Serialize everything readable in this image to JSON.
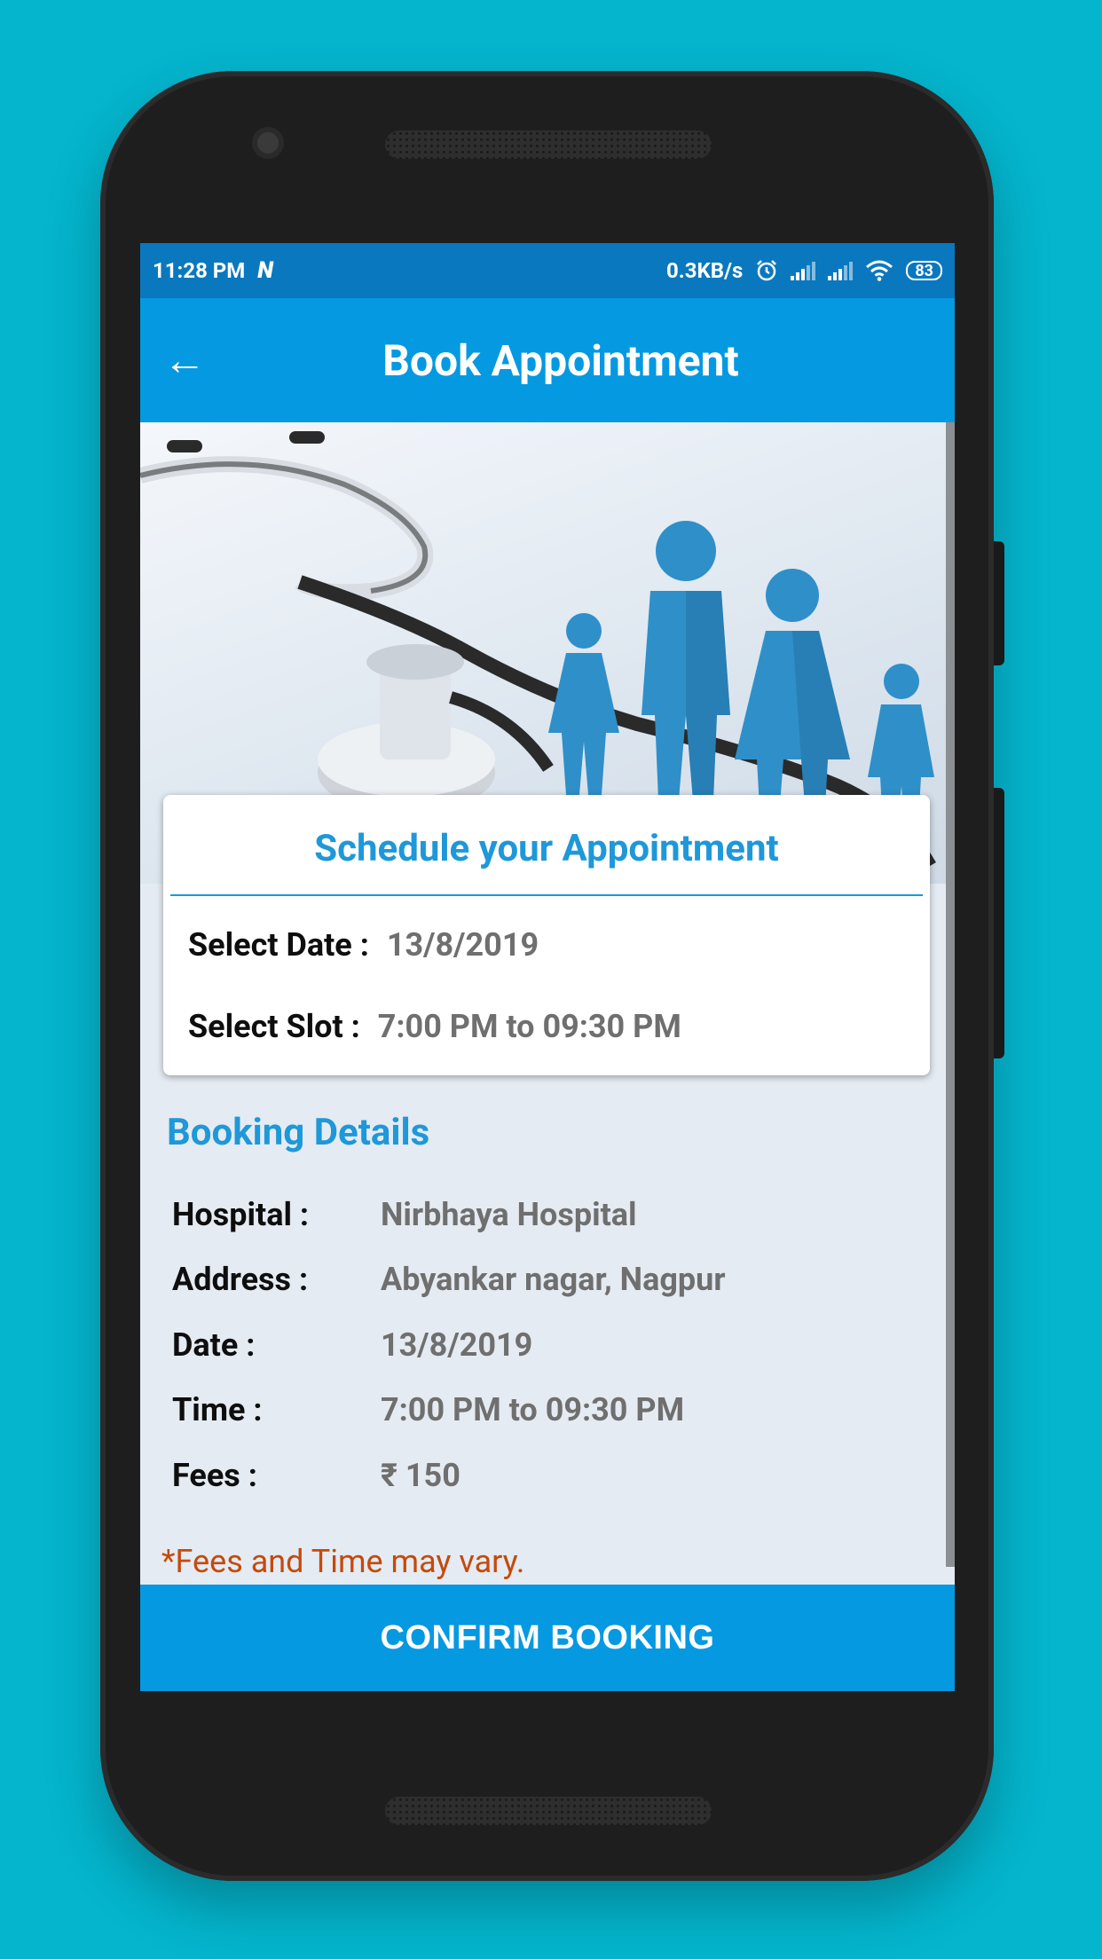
{
  "status_bar": {
    "time": "11:28 PM",
    "notification_icon": "N",
    "network_speed": "0.3KB/s",
    "battery": "83"
  },
  "app_bar": {
    "back_icon": "←",
    "title": "Book Appointment"
  },
  "schedule_card": {
    "title": "Schedule your Appointment",
    "date_label": "Select Date :",
    "date_value": "13/8/2019",
    "slot_label": "Select Slot :",
    "slot_value": "7:00 PM to 09:30 PM"
  },
  "booking_details": {
    "title": "Booking Details",
    "rows": [
      {
        "label": "Hospital :",
        "value": "Nirbhaya Hospital"
      },
      {
        "label": "Address :",
        "value": "Abyankar nagar, Nagpur"
      },
      {
        "label": "Date :",
        "value": "13/8/2019"
      },
      {
        "label": "Time :",
        "value": "7:00 PM to 09:30 PM"
      },
      {
        "label": "Fees :",
        "value": "₹ 150"
      }
    ],
    "note": "*Fees and Time may vary."
  },
  "confirm_button": "CONFIRM BOOKING",
  "colors": {
    "background": "#04b5cd",
    "status_bar": "#0a78be",
    "app_bar": "#0599e1",
    "accent": "#1e98d8",
    "note": "#c44a0c"
  }
}
